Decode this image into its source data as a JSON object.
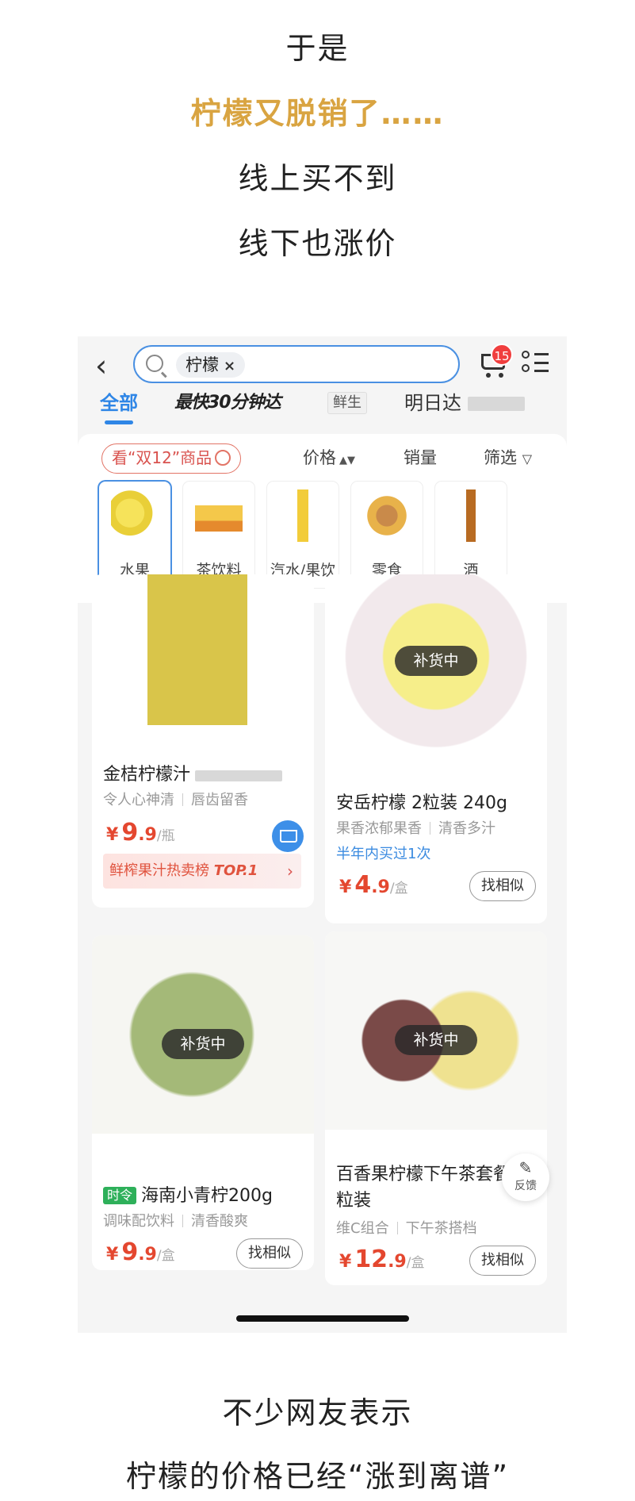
{
  "captions": {
    "line1": "于是",
    "line2": "柠檬又脱销了……",
    "line3": "线上买不到",
    "line4": "线下也涨价",
    "line5": "不少网友表示",
    "line6": "柠檬的价格已经“涨到离谱”"
  },
  "app": {
    "search_chip": "柠檬",
    "chip_clear": "×",
    "cart_badge": "15",
    "tabs": [
      "全部",
      "最快30分钟达",
      "鲜生",
      "明日达"
    ],
    "promo_label": "看“双12”商品",
    "sort": {
      "price": "价格",
      "price_arrows": "▲▼",
      "sales": "销量",
      "filter": "筛选",
      "filter_icon": "▽"
    },
    "categories": [
      "水果",
      "茶饮料",
      "汽水/果饮",
      "零食",
      "酒"
    ],
    "products": [
      {
        "title": "金桔柠檬汁",
        "sub1": "令人心神清",
        "sub2": "唇齿留香",
        "price_int": "9",
        "price_dec": ".9",
        "unit": "/瓶",
        "rank_text": "鲜榨果汁热卖榜",
        "rank_top": "TOP.1"
      },
      {
        "title": "安岳柠檬 2粒装 240g",
        "sub1": "果香浓郁果香",
        "sub2": "清香多汁",
        "note": "半年内买过1次",
        "price_int": "4",
        "price_dec": ".9",
        "unit": "/盒",
        "restock": "补货中",
        "similar": "找相似"
      },
      {
        "tag": "时令",
        "title": "海南小青柠200g",
        "sub1": "调味配饮料",
        "sub2": "清香酸爽",
        "price_int": "9",
        "price_dec": ".9",
        "unit": "/盒",
        "restock": "补货中",
        "similar": "找相似"
      },
      {
        "title_line1": "百香果柠檬下午茶套餐",
        "title_line2": "粒装",
        "sub1": "维C组合",
        "sub2": "下午茶搭档",
        "price_int": "12",
        "price_dec": ".9",
        "unit": "/盒",
        "restock": "补货中",
        "similar": "找相似"
      }
    ],
    "feedback": "反馈",
    "currency": "¥"
  },
  "colors": {
    "accent_blue": "#2f86e6",
    "price_red": "#e4472f",
    "caption_gold": "#d9a441"
  }
}
